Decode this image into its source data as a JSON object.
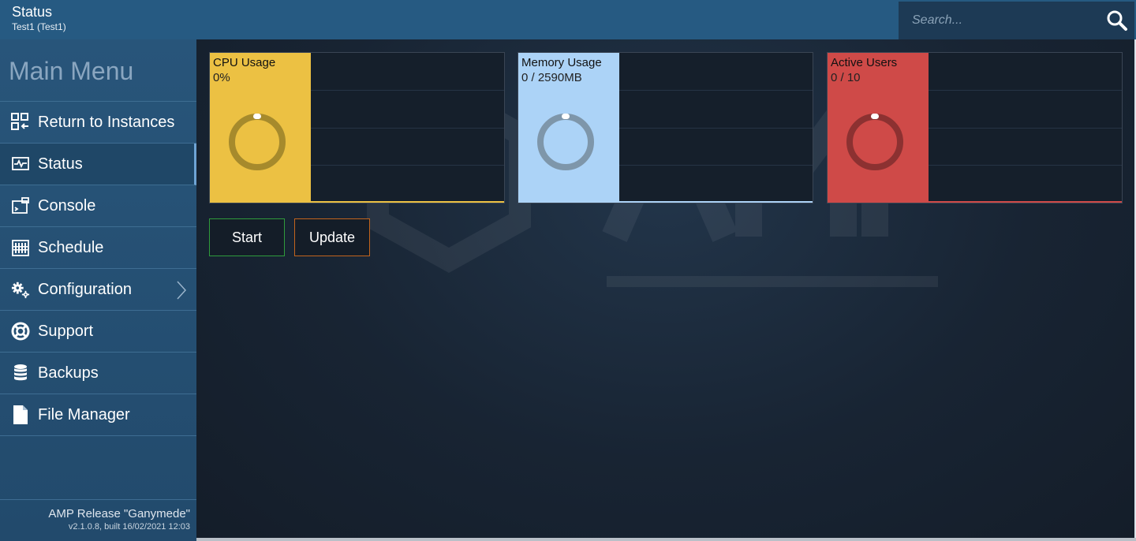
{
  "header": {
    "title": "Status",
    "subtitle": "Test1 (Test1)"
  },
  "search": {
    "placeholder": "Search..."
  },
  "sidebar": {
    "title": "Main Menu",
    "items": [
      {
        "label": "Return to Instances",
        "icon": "instances-icon"
      },
      {
        "label": "Status",
        "icon": "status-monitor-icon",
        "active": true
      },
      {
        "label": "Console",
        "icon": "console-icon"
      },
      {
        "label": "Schedule",
        "icon": "schedule-icon"
      },
      {
        "label": "Configuration",
        "icon": "gears-icon",
        "has_submenu": true
      },
      {
        "label": "Support",
        "icon": "lifebuoy-icon"
      },
      {
        "label": "Backups",
        "icon": "database-icon"
      },
      {
        "label": "File Manager",
        "icon": "file-icon"
      }
    ],
    "footer": {
      "release": "AMP Release \"Ganymede\"",
      "build": "v2.1.0.8, built 16/02/2021 12:03"
    }
  },
  "cards": [
    {
      "title": "CPU Usage",
      "value": "0%",
      "color": "#ecc143",
      "ring": "#a68a2c",
      "fraction": 0
    },
    {
      "title": "Memory Usage",
      "value": "0 / 2590MB",
      "color": "#acd3f7",
      "ring": "#7e96aa",
      "fraction": 0
    },
    {
      "title": "Active Users",
      "value": "0 / 10",
      "color": "#cf4a48",
      "ring": "#8c3131",
      "fraction": 0
    }
  ],
  "buttons": {
    "start": "Start",
    "update": "Update"
  },
  "colors": {
    "header_bg": "#265a82",
    "sidebar_bg": "#28557a",
    "main_bg": "#182433",
    "start_border": "#2f9b3c",
    "update_border": "#c2641d"
  }
}
